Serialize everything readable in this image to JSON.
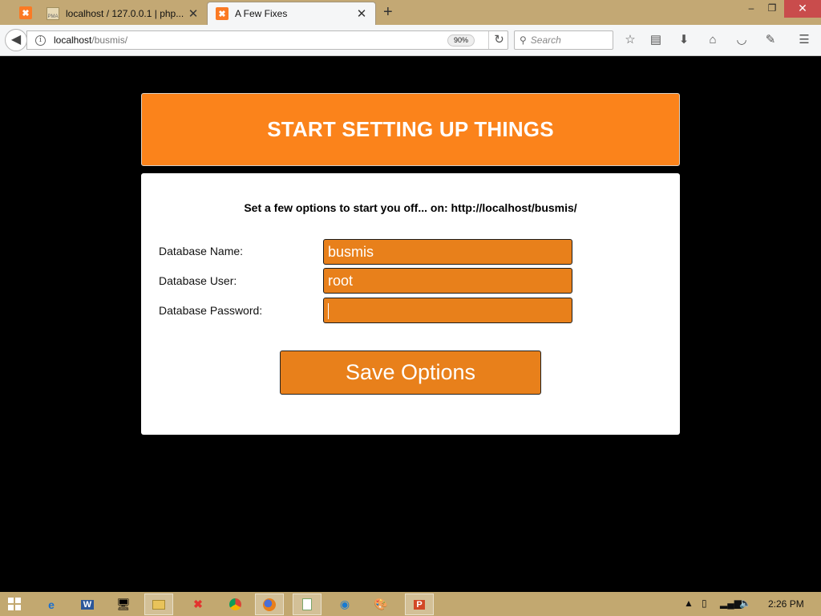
{
  "browser": {
    "tabs": [
      {
        "title": "localhost / 127.0.0.1 | php...",
        "close": "✕",
        "active": false
      },
      {
        "title": "A Few Fixes",
        "close": "✕",
        "active": true
      }
    ],
    "new_tab": "+",
    "window": {
      "minimize": "–",
      "restore": "❐",
      "close": "✕"
    },
    "url_host": "localhost",
    "url_path": "/busmis/",
    "zoom": "90%",
    "search_placeholder": "Search",
    "toolbar_icons": [
      "star-icon",
      "reading-list-icon",
      "download-icon",
      "home-icon",
      "pocket-icon",
      "eyedropper-icon",
      "menu-icon"
    ]
  },
  "page": {
    "banner_title": "START SETTING UP THINGS",
    "intro": "Set a few options to start you off... on: http://localhost/busmis/",
    "fields": [
      {
        "label": "Database Name:",
        "value": "busmis"
      },
      {
        "label": "Database User:",
        "value": "root"
      },
      {
        "label": "Database Password:",
        "value": ""
      }
    ],
    "save_label": "Save Options"
  },
  "taskbar": {
    "apps": [
      "internet-explorer-icon",
      "word-icon",
      "remote-desktop-icon",
      "file-explorer-icon",
      "xampp-icon",
      "chrome-icon",
      "firefox-icon",
      "notepad-icon",
      "edge-icon",
      "paint-icon",
      "powerpoint-icon"
    ],
    "clock": "2:26 PM"
  },
  "colors": {
    "accent": "#fb831b",
    "field_bg": "#e8801b",
    "page_bg": "#000000",
    "card_bg": "#ffffff",
    "tabstrip_bg": "#c3a874"
  }
}
